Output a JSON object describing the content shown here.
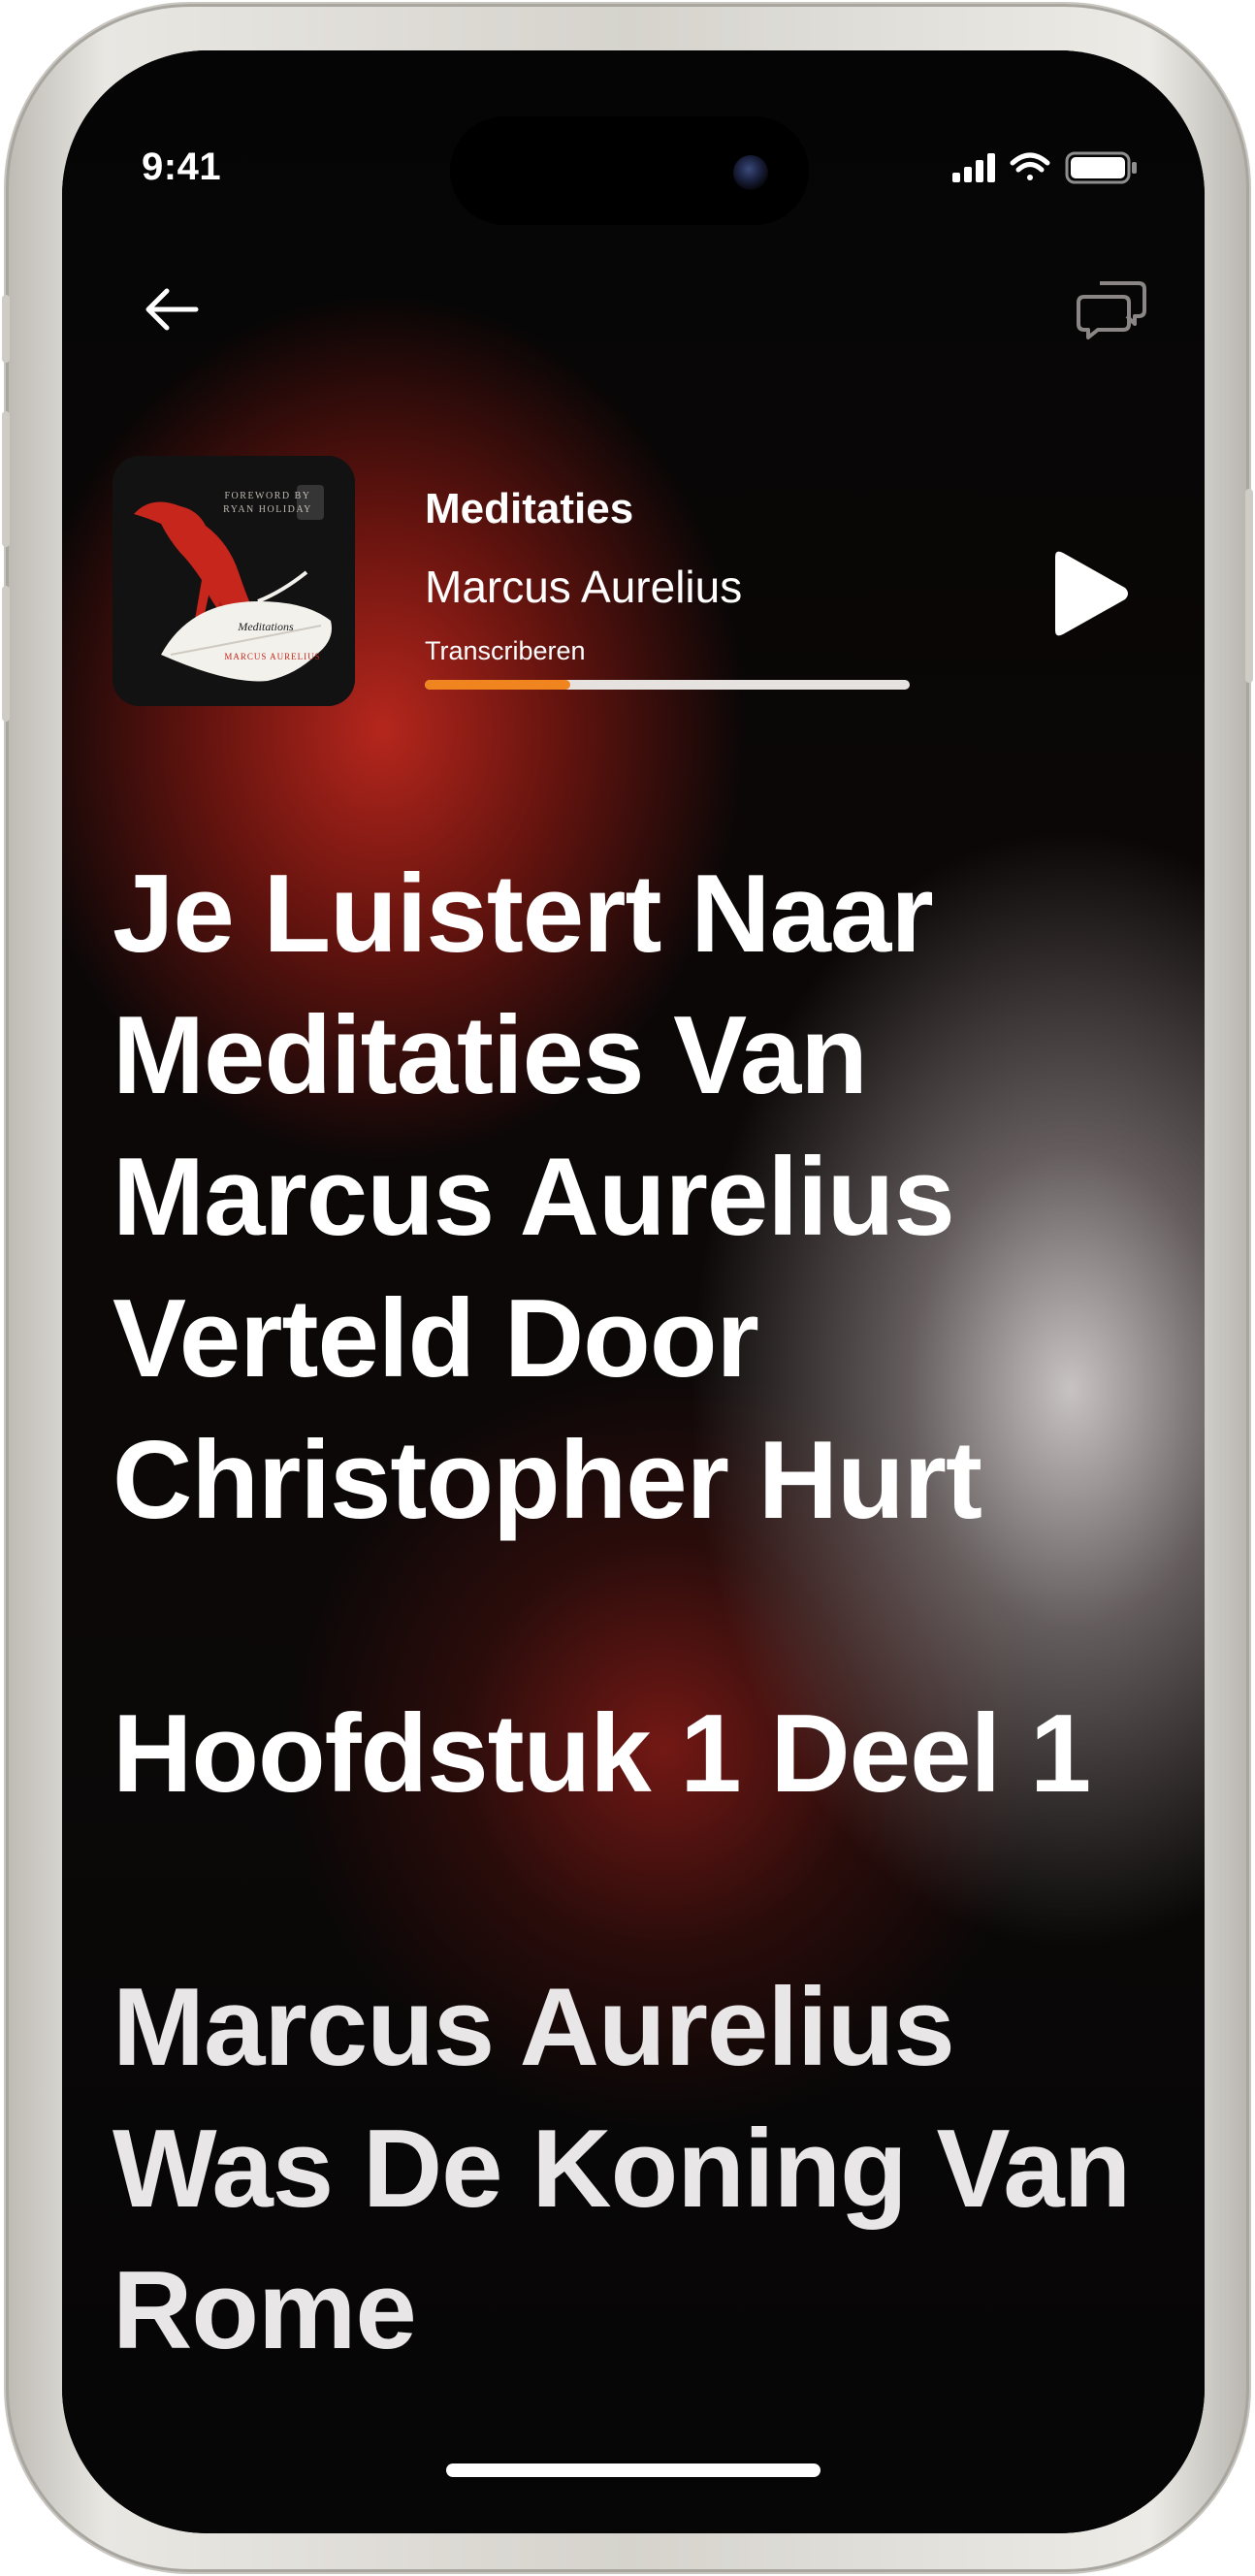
{
  "status_bar": {
    "time": "9:41"
  },
  "nav": {
    "back_icon": "arrow-left-icon",
    "chat_icon": "chat-bubbles-icon"
  },
  "player": {
    "cover_title": "Meditations",
    "cover_author": "MARCUS AURELIUS",
    "cover_foreword_line1": "FOREWORD BY",
    "cover_foreword_line2": "RYAN HOLIDAY",
    "title": "Meditaties",
    "author": "Marcus Aurelius",
    "status": "Transcriberen",
    "progress": 0.3,
    "play_icon": "play-icon",
    "accent_color": "#f0851f"
  },
  "transcript": {
    "paragraphs": [
      "Je Luistert Naar Meditaties Van Marcus Aurelius Verteld Door Christopher Hurt",
      "Hoofdstuk 1 Deel 1",
      "Marcus Aurelius Was De Koning Van Rome"
    ]
  }
}
